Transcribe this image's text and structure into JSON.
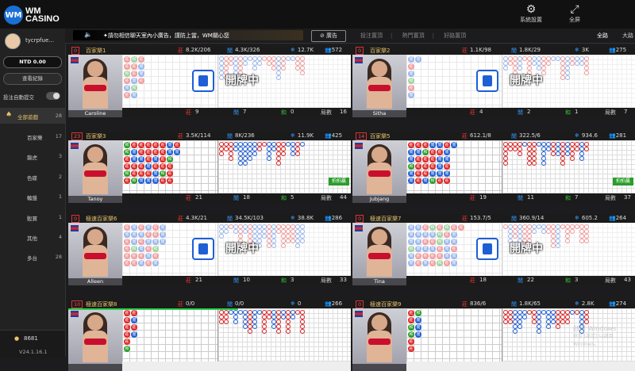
{
  "header": {
    "logo_letters": "WM",
    "logo_line1": "WM",
    "logo_line2": "CASINO",
    "settings_label": "系統設置",
    "fullscreen_label": "全屏"
  },
  "sidebar": {
    "username": "tycrpfue...",
    "balance": "NTD 0.00",
    "history_label": "查看紀錄",
    "auto_submit_label": "投注自動提交",
    "all_games_label": "全部遊戲",
    "all_games_count": "28",
    "categories": [
      {
        "label": "百家樂",
        "count": "17"
      },
      {
        "label": "龍虎",
        "count": "3"
      },
      {
        "label": "色碟",
        "count": "2"
      },
      {
        "label": "輪盤",
        "count": "1"
      },
      {
        "label": "骰寶",
        "count": "1"
      },
      {
        "label": "其他",
        "count": "4"
      },
      {
        "label": "多台",
        "count": "28"
      }
    ],
    "points": "8681",
    "version": "V24.1.16.1"
  },
  "toolbar": {
    "marquee_text": "✦請勿相信聊天室內小廣告，謹防上當，WM關心您",
    "ad_button": "廣告",
    "tab1": "投注置頂",
    "tab2": "熱門置頂",
    "tab3": "好路置頂",
    "tab_all": "全路",
    "tab_big": "大路"
  },
  "tables": [
    {
      "num": "0",
      "name": "百家樂1",
      "bank_bet": "8.2K/206",
      "player_bet": "4.3K/326",
      "total": "12.7K",
      "players": "572",
      "dealer": "Caroline",
      "banker": "9",
      "player": "7",
      "tie": "0",
      "rounds": "16",
      "state": "開牌中"
    },
    {
      "num": "0",
      "name": "百家樂2",
      "bank_bet": "1.1K/98",
      "player_bet": "1.8K/29",
      "total": "3K",
      "players": "275",
      "dealer": "Sitha",
      "banker": "4",
      "player": "2",
      "tie": "1",
      "rounds": "7",
      "state": "開牌中"
    },
    {
      "num": "23",
      "name": "百家樂3",
      "bank_bet": "3.5K/114",
      "player_bet": "8K/236",
      "total": "11.9K",
      "players": "425",
      "dealer": "Tanoy",
      "banker": "21",
      "player": "18",
      "tie": "5",
      "rounds": "44",
      "badge": "拍拍贏"
    },
    {
      "num": "14",
      "name": "百家樂5",
      "bank_bet": "612.1/8",
      "player_bet": "322.5/6",
      "total": "934.6",
      "players": "281",
      "dealer": "Jubjang",
      "banker": "19",
      "player": "11",
      "tie": "7",
      "rounds": "37",
      "badge": "拍拍贏"
    },
    {
      "num": "0",
      "name": "極速百家樂6",
      "bank_bet": "4.3K/21",
      "player_bet": "34.5K/103",
      "total": "38.8K",
      "players": "286",
      "dealer": "Alleen",
      "banker": "21",
      "player": "10",
      "tie": "3",
      "rounds": "33",
      "state": "開牌中"
    },
    {
      "num": "0",
      "name": "極速百家樂7",
      "bank_bet": "153.7/5",
      "player_bet": "360.9/14",
      "total": "605.2",
      "players": "264",
      "dealer": "Tina",
      "banker": "18",
      "player": "22",
      "tie": "3",
      "rounds": "43",
      "state": "開牌中"
    },
    {
      "num": "10",
      "name": "極速百家樂8",
      "bank_bet": "0/0",
      "player_bet": "0/0",
      "total": "0",
      "players": "266",
      "dealer": "",
      "banker": "",
      "player": "",
      "tie": "",
      "rounds": "",
      "progress": 0.6
    },
    {
      "num": "0",
      "name": "極速百家樂9",
      "bank_bet": "836/6",
      "player_bet": "1.8K/65",
      "total": "2.8K",
      "players": "274",
      "dealer": "",
      "banker": "",
      "player": "",
      "tie": "",
      "rounds": ""
    }
  ],
  "labels": {
    "banker": "莊",
    "player": "閒",
    "tie": "和",
    "rounds": "局數",
    "sep": "/"
  },
  "watermark": {
    "line1": "啟用 Windows",
    "line2": "移至 [設定] 以啟用 Windows。"
  }
}
